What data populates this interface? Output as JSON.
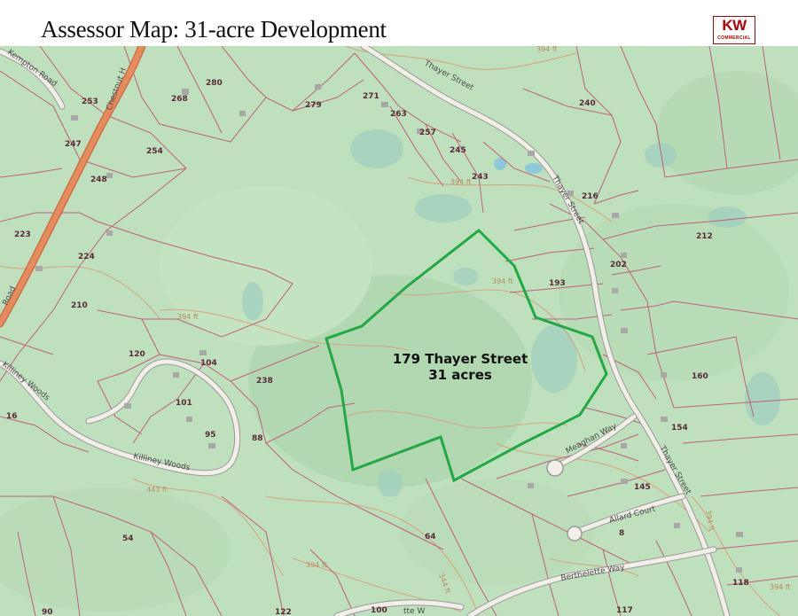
{
  "header": {
    "title": "Assessor Map: 31-acre Development",
    "logo_mark": "KW",
    "logo_sub": "COMMERCIAL"
  },
  "map": {
    "colors": {
      "base": "#bfe0bd",
      "parcel_line": "#c0607a",
      "contour": "#d9a27c",
      "boundary": "#22a845",
      "main_road": "#e88a5c",
      "water": "#8ec9d9"
    },
    "development": {
      "address": "179 Thayer Street",
      "area": "31 acres"
    },
    "streets": {
      "thayer_top": "Thayer Street",
      "thayer_mid": "Thayer Street",
      "thayer_lower": "Thayer Street",
      "kempton": "Kempton Road",
      "chestnut": "Chestnut H",
      "road_left": "Road",
      "killiney_left": "Killiney Woods",
      "killiney_bottom": "Killiney Woods",
      "meaghan": "Meaghan Way",
      "allard": "Allard Court",
      "berthelette": "Berthelette Way",
      "bottom_partial": "tte W"
    },
    "contours": {
      "c1": "394 ft",
      "c2": "394 ft",
      "c3": "394 ft",
      "c4": "394 ft",
      "c5": "394 ft",
      "c6": "443 ft",
      "c7": "344 ft",
      "c8": "394 ft",
      "c9": "394 ft"
    },
    "lots": {
      "l253": "253",
      "l268": "268",
      "l280": "280",
      "l271": "271",
      "l279": "279",
      "l263": "263",
      "l257": "257",
      "l240": "240",
      "l247": "247",
      "l254": "254",
      "l245": "245",
      "l243": "243",
      "l248": "248",
      "l216": "216",
      "l223": "223",
      "l224": "224",
      "l212": "212",
      "l202": "202",
      "l193": "193",
      "l210": "210",
      "l120": "120",
      "l104": "104",
      "l238": "238",
      "l160": "160",
      "l101": "101",
      "l16": "16",
      "l95": "95",
      "l88": "88",
      "l154": "154",
      "l145": "145",
      "l8": "8",
      "l54": "54",
      "l64": "64",
      "l118": "118",
      "l90": "90",
      "l122": "122",
      "l100": "100",
      "l117": "117"
    }
  }
}
